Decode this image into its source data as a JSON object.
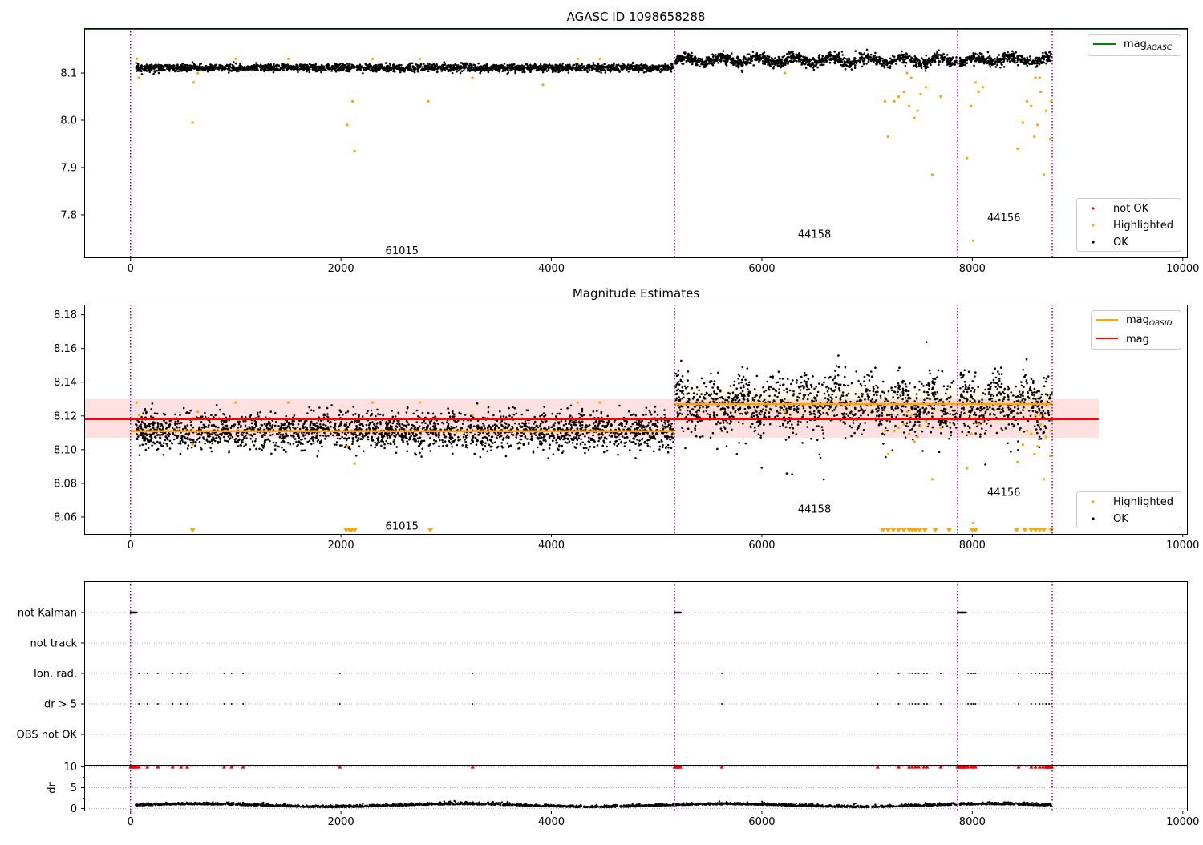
{
  "chart_data": [
    {
      "type": "scatter",
      "title": "AGASC ID 1098658288",
      "xlim": [
        -440,
        10040
      ],
      "ylim": [
        7.71,
        8.195
      ],
      "xticks": [
        0,
        2000,
        4000,
        6000,
        8000,
        10000
      ],
      "xtick_labels": [
        "0",
        "2000",
        "4000",
        "6000",
        "8000",
        "10000"
      ],
      "yticks": [
        7.8,
        7.9,
        8.0,
        8.1
      ],
      "ytick_labels": [
        "7.8",
        "7.9",
        "8.0",
        "8.1"
      ],
      "colors": {
        "mag_agasc": "#008000",
        "not_ok": "#ff0000",
        "highlighted": "#ffa500",
        "ok": "#000000",
        "obs_boundary": "#800080"
      },
      "obs_boundaries": [
        0,
        5170,
        7860,
        8760
      ],
      "obs_labels": [
        {
          "text": "61015",
          "x": 2580,
          "y": 7.725
        },
        {
          "text": "44158",
          "x": 6500,
          "y": 7.76
        },
        {
          "text": "44156",
          "x": 8300,
          "y": 7.795
        }
      ],
      "mag_agasc": 8.195,
      "series": [
        {
          "name": "OK",
          "segments": [
            {
              "x_range": [
                50,
                5160
              ],
              "center": 8.111,
              "spread": 0.012
            },
            {
              "x_range": [
                5180,
                7850
              ],
              "center": 8.127,
              "spread": 0.018
            },
            {
              "x_range": [
                7880,
                8755
              ],
              "center": 8.128,
              "spread": 0.018
            }
          ]
        },
        {
          "name": "Highlighted",
          "points": [
            [
              60,
              8.13
            ],
            [
              80,
              8.09
            ],
            [
              590,
              7.995
            ],
            [
              600,
              8.08
            ],
            [
              640,
              8.1
            ],
            [
              2060,
              7.99
            ],
            [
              2110,
              8.04
            ],
            [
              2130,
              7.935
            ],
            [
              2830,
              8.04
            ],
            [
              3250,
              8.09
            ],
            [
              3920,
              8.075
            ],
            [
              1000,
              8.13
            ],
            [
              1500,
              8.13
            ],
            [
              2300,
              8.13
            ],
            [
              2750,
              8.13
            ],
            [
              4250,
              8.13
            ],
            [
              4460,
              8.13
            ],
            [
              6220,
              8.1
            ],
            [
              7170,
              8.04
            ],
            [
              7200,
              7.965
            ],
            [
              7260,
              8.04
            ],
            [
              7300,
              8.05
            ],
            [
              7350,
              8.06
            ],
            [
              7400,
              8.03
            ],
            [
              7450,
              8.005
            ],
            [
              7480,
              8.02
            ],
            [
              7510,
              8.055
            ],
            [
              7560,
              8.07
            ],
            [
              7620,
              7.885
            ],
            [
              7700,
              8.05
            ],
            [
              7380,
              8.1
            ],
            [
              7420,
              8.09
            ],
            [
              7950,
              7.92
            ],
            [
              7990,
              8.03
            ],
            [
              8010,
              7.745
            ],
            [
              8030,
              8.08
            ],
            [
              8060,
              8.06
            ],
            [
              8100,
              8.07
            ],
            [
              8430,
              7.94
            ],
            [
              8480,
              7.995
            ],
            [
              8520,
              8.04
            ],
            [
              8560,
              8.03
            ],
            [
              8590,
              7.965
            ],
            [
              8620,
              7.99
            ],
            [
              8650,
              8.06
            ],
            [
              8680,
              7.885
            ],
            [
              8700,
              8.02
            ],
            [
              8740,
              7.96
            ],
            [
              8750,
              8.04
            ],
            [
              8600,
              8.09
            ],
            [
              8640,
              8.09
            ]
          ]
        },
        {
          "name": "not OK",
          "points": []
        }
      ],
      "legend": {
        "placement": "top-right",
        "line": "mag",
        "line_sub": "AGASC"
      },
      "legend2": {
        "placement": "lower-right",
        "entries": [
          "not OK",
          "Highlighted",
          "OK"
        ]
      }
    },
    {
      "type": "scatter",
      "title": "Magnitude Estimates",
      "xlim": [
        -440,
        10040
      ],
      "ylim": [
        8.05,
        8.186
      ],
      "xticks": [
        0,
        2000,
        4000,
        6000,
        8000,
        10000
      ],
      "xtick_labels": [
        "0",
        "2000",
        "4000",
        "6000",
        "8000",
        "10000"
      ],
      "yticks": [
        8.06,
        8.08,
        8.1,
        8.12,
        8.14,
        8.16,
        8.18
      ],
      "ytick_labels": [
        "8.06",
        "8.08",
        "8.10",
        "8.12",
        "8.14",
        "8.16",
        "8.18"
      ],
      "mag": 8.118,
      "mag_band": [
        8.107,
        8.13
      ],
      "mag_obsid": [
        {
          "x_range": [
            0,
            5170
          ],
          "value": 8.111
        },
        {
          "x_range": [
            5170,
            7860
          ],
          "value": 8.127
        },
        {
          "x_range": [
            7860,
            8760
          ],
          "value": 8.127
        }
      ],
      "obs_labels": [
        {
          "text": "61015",
          "x": 2580,
          "y": 8.055
        },
        {
          "text": "44158",
          "x": 6500,
          "y": 8.065
        },
        {
          "text": "44156",
          "x": 8300,
          "y": 8.075
        }
      ],
      "clipped_lower_x": [
        590,
        2050,
        2080,
        2100,
        2130,
        2850,
        7150,
        7200,
        7250,
        7300,
        7350,
        7400,
        7430,
        7460,
        7500,
        7550,
        7650,
        7780,
        8000,
        8030,
        8420,
        8500,
        8560,
        8600,
        8640,
        8680,
        8750
      ],
      "legend": {
        "placement": "top-right",
        "lines": [
          {
            "name": "mag",
            "sub": "OBSID",
            "color": "#ffa500"
          },
          {
            "name": "mag",
            "sub": "",
            "color": "#ff0000"
          }
        ]
      },
      "legend2": {
        "placement": "lower-right",
        "entries": [
          "Highlighted",
          "OK"
        ]
      }
    },
    {
      "type": "scatter",
      "title": "",
      "xlim": [
        -440,
        10040
      ],
      "categories": [
        "not Kalman",
        "not track",
        "Ion. rad.",
        "dr > 5",
        "OBS not OK"
      ],
      "flag_x": {
        "not Kalman": [
          [
            0,
            60
          ],
          [
            5170,
            5230
          ],
          [
            7860,
            7940
          ]
        ],
        "not track": [],
        "Ion. rad.": [
          80,
          160,
          260,
          400,
          480,
          540,
          890,
          960,
          1070,
          1990,
          3250,
          5620,
          7100,
          7300,
          7400,
          7430,
          7460,
          7490,
          7540,
          7570,
          7700,
          7960,
          7990,
          8010,
          8030,
          8440,
          8560,
          8600,
          8640,
          8670,
          8700,
          8730,
          8750
        ],
        "dr > 5": [
          80,
          160,
          260,
          400,
          480,
          540,
          890,
          960,
          1070,
          1990,
          3250,
          5620,
          7100,
          7300,
          7400,
          7430,
          7460,
          7490,
          7540,
          7570,
          7700,
          7960,
          7990,
          8010,
          8030,
          8440,
          8560,
          8600,
          8640,
          8670,
          8700,
          8730,
          8750
        ],
        "OBS not OK": []
      },
      "dr": {
        "ylabel": "dr",
        "ylim": [
          -0.5,
          10.5
        ],
        "yticks": [
          0,
          5,
          10
        ],
        "ytick_labels": [
          "0",
          "5",
          "10"
        ],
        "clip": 10,
        "typical": 0.6
      }
    }
  ]
}
